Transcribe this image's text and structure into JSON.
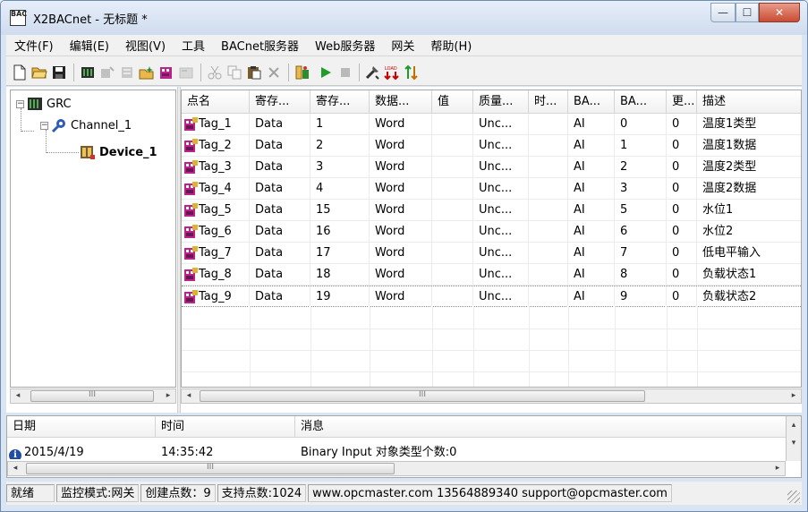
{
  "window": {
    "title": "X2BACnet - 无标题 *",
    "icon_text": "BAC",
    "controls": {
      "minimize": "—",
      "maximize": "☐",
      "close": "✕"
    }
  },
  "menu": [
    "文件(F)",
    "编辑(E)",
    "视图(V)",
    "工具",
    "BACnet服务器",
    "Web服务器",
    "网关",
    "帮助(H)"
  ],
  "toolbar": {
    "icons": [
      "new-file-icon",
      "open-folder-icon",
      "save-icon",
      "add-channel-icon",
      "add-device-icon-disabled",
      "add-group-icon-disabled",
      "add-tag-icon",
      "tag-batch-icon",
      "properties-icon-disabled",
      "cut-icon-disabled",
      "copy-icon-disabled",
      "paste-icon",
      "delete-icon-disabled",
      "monitor-icon",
      "run-icon",
      "stop-icon",
      "tools-icon",
      "load-icon",
      "transfer-icon"
    ]
  },
  "tree": {
    "root": "GRC",
    "channel": "Channel_1",
    "device": "Device_1"
  },
  "grid": {
    "columns": [
      "点名",
      "寄存...",
      "寄存...",
      "数据...",
      "值",
      "质量...",
      "时...",
      "BA...",
      "BA...",
      "更...",
      "描述"
    ],
    "rows": [
      [
        "Tag_1",
        "Data",
        "1",
        "Word",
        "",
        "Unc...",
        "",
        "AI",
        "0",
        "0",
        "温度1类型"
      ],
      [
        "Tag_2",
        "Data",
        "2",
        "Word",
        "",
        "Unc...",
        "",
        "AI",
        "1",
        "0",
        "温度1数据"
      ],
      [
        "Tag_3",
        "Data",
        "3",
        "Word",
        "",
        "Unc...",
        "",
        "AI",
        "2",
        "0",
        "温度2类型"
      ],
      [
        "Tag_4",
        "Data",
        "4",
        "Word",
        "",
        "Unc...",
        "",
        "AI",
        "3",
        "0",
        "温度2数据"
      ],
      [
        "Tag_5",
        "Data",
        "15",
        "Word",
        "",
        "Unc...",
        "",
        "AI",
        "5",
        "0",
        "水位1"
      ],
      [
        "Tag_6",
        "Data",
        "16",
        "Word",
        "",
        "Unc...",
        "",
        "AI",
        "6",
        "0",
        "水位2"
      ],
      [
        "Tag_7",
        "Data",
        "17",
        "Word",
        "",
        "Unc...",
        "",
        "AI",
        "7",
        "0",
        "低电平输入"
      ],
      [
        "Tag_8",
        "Data",
        "18",
        "Word",
        "",
        "Unc...",
        "",
        "AI",
        "8",
        "0",
        "负载状态1"
      ],
      [
        "Tag_9",
        "Data",
        "19",
        "Word",
        "",
        "Unc...",
        "",
        "AI",
        "9",
        "0",
        "负载状态2"
      ]
    ]
  },
  "scroll": {
    "thumb_grip": "III",
    "left_arrow": "◂",
    "right_arrow": "▸",
    "up_arrow": "▴",
    "down_arrow": "▾"
  },
  "log": {
    "columns": [
      "日期",
      "时间",
      "消息"
    ],
    "entry": {
      "date": "2015/4/19",
      "time": "14:35:42",
      "message": "Binary Input 对象类型个数:0"
    }
  },
  "status": {
    "ready": "就绪",
    "mode": "监控模式:网关",
    "created": "创建点数：9",
    "supported": "支持点数:1024",
    "contact": "www.opcmaster.com 13564889340 support@opcmaster.com"
  },
  "colors": {
    "titlebar": "#d3dff0",
    "close": "#c94c33",
    "tag_icon": "#b8248c",
    "info": "#1f4f9e"
  }
}
